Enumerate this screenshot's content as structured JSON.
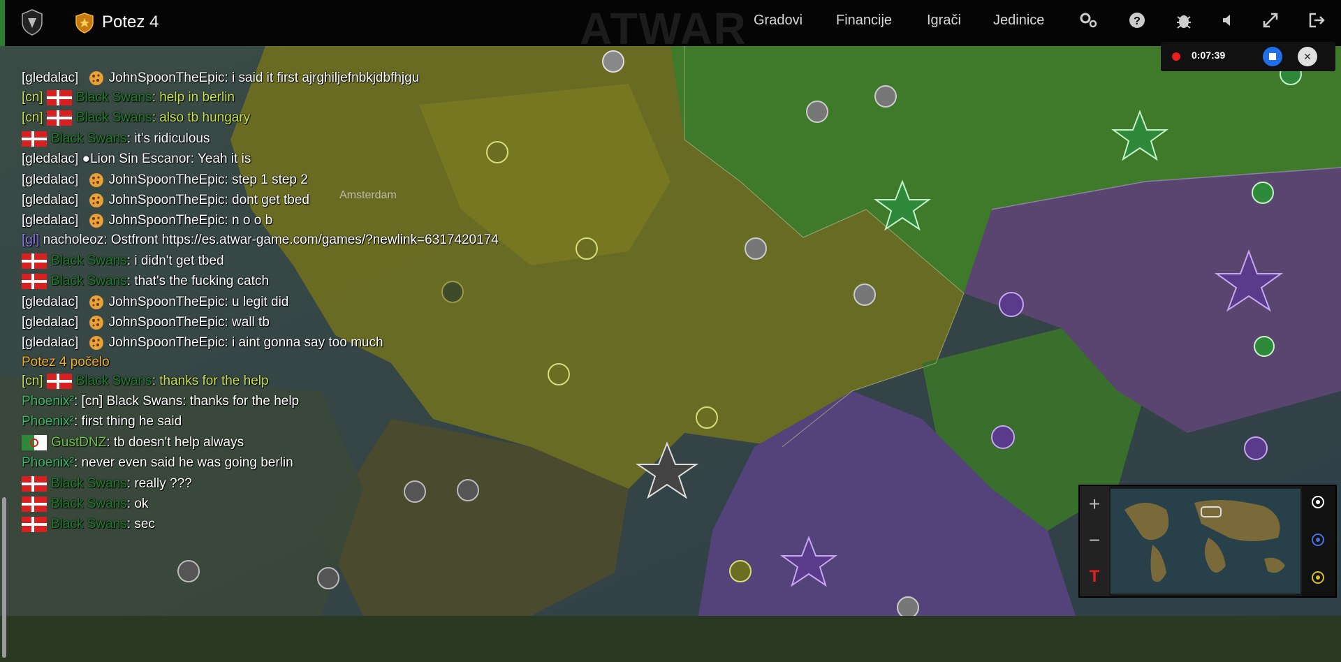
{
  "topbar": {
    "turn_label": "Potez 4",
    "watermark": "ATWAR",
    "nav": [
      "Gradovi",
      "Financije",
      "Igrači",
      "Jedinice"
    ],
    "icons": [
      "gear-icon",
      "help-icon",
      "bug-icon",
      "sound-icon",
      "fullscreen-icon",
      "exit-icon"
    ]
  },
  "recorder": {
    "time": "0:07:39"
  },
  "map_labels": {
    "amsterdam": "Amsterdam"
  },
  "chat": {
    "lines": [
      {
        "tag": "[gledalac]",
        "name": "JohnSpoonTheEpic",
        "msg": ": i said it first ajrghiljefnbkjdbfhjgu",
        "kind": "spectator"
      },
      {
        "tag": "[cn]",
        "name": "Black Swans",
        "msg": ": help in berlin",
        "kind": "alliance"
      },
      {
        "tag": "[cn]",
        "name": "Black Swans",
        "msg": ": also tb hungary",
        "kind": "alliance"
      },
      {
        "tag": "",
        "name": "Black Swans",
        "msg": ": it's ridiculous",
        "kind": "player"
      },
      {
        "tag": "[gledalac]",
        "name": "●Lion Sin Escanor",
        "msg": ": Yeah it is",
        "kind": "spectator-plain"
      },
      {
        "tag": "[gledalac]",
        "name": "JohnSpoonTheEpic",
        "msg": ": step 1 step 2",
        "kind": "spectator"
      },
      {
        "tag": "[gledalac]",
        "name": "JohnSpoonTheEpic",
        "msg": ": dont get tbed",
        "kind": "spectator"
      },
      {
        "tag": "[gledalac]",
        "name": "JohnSpoonTheEpic",
        "msg": ": n o o b",
        "kind": "spectator"
      },
      {
        "tag": "[gl]",
        "name": "nacholeoz",
        "msg": ": Ostfront https://es.atwar-game.com/games/?newlink=6317420174",
        "kind": "global"
      },
      {
        "tag": "",
        "name": "Black Swans",
        "msg": ": i didn't get tbed",
        "kind": "player"
      },
      {
        "tag": "",
        "name": "Black Swans",
        "msg": ": that's the fucking catch",
        "kind": "player"
      },
      {
        "tag": "[gledalac]",
        "name": "JohnSpoonTheEpic",
        "msg": ": u legit did",
        "kind": "spectator"
      },
      {
        "tag": "[gledalac]",
        "name": "JohnSpoonTheEpic",
        "msg": ": wall tb",
        "kind": "spectator"
      },
      {
        "tag": "[gledalac]",
        "name": "JohnSpoonTheEpic",
        "msg": ": i aint gonna say too much",
        "kind": "spectator"
      },
      {
        "tag": "",
        "name": "",
        "msg": "Potez 4 počelo",
        "kind": "system"
      },
      {
        "tag": "[cn]",
        "name": "Black Swans",
        "msg": ": thanks for the help",
        "kind": "alliance"
      },
      {
        "tag": "",
        "name": "Phoenix²",
        "msg": ": [cn] Black Swans: thanks for the help",
        "kind": "phoenix"
      },
      {
        "tag": "",
        "name": "Phoenix²",
        "msg": ": first thing he said",
        "kind": "phoenix"
      },
      {
        "tag": "",
        "name": "GustDNZ",
        "msg": ": tb doesn't help always",
        "kind": "gust"
      },
      {
        "tag": "",
        "name": "Phoenix²",
        "msg": ": never even said he was going berlin",
        "kind": "phoenix"
      },
      {
        "tag": "",
        "name": "Black Swans",
        "msg": ": really ???",
        "kind": "player"
      },
      {
        "tag": "",
        "name": "Black Swans",
        "msg": ": ok",
        "kind": "player"
      },
      {
        "tag": "",
        "name": "Black Swans",
        "msg": ": sec",
        "kind": "player"
      }
    ]
  },
  "minimap": {
    "zoom_in": "+",
    "zoom_out": "−",
    "text_toggle": "T"
  },
  "colors": {
    "alliance_tag": "#c6e04b",
    "global_tag": "#8a7be8",
    "system": "#f0b020",
    "black_swans": "#1f7a2b",
    "phoenix": "#3cb56a"
  }
}
